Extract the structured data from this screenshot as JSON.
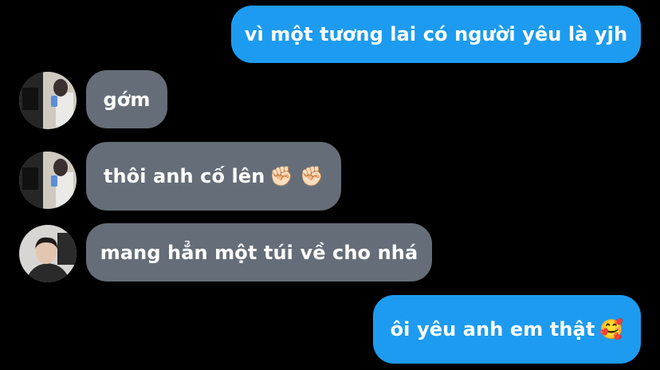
{
  "conversation": {
    "messages": [
      {
        "direction": "outgoing",
        "text": "vì một tương lai có người yêu là yjh"
      },
      {
        "direction": "incoming",
        "sender_avatar": "mirror-selfie-avatar",
        "text": "gớm"
      },
      {
        "direction": "incoming",
        "sender_avatar": "mirror-selfie-avatar",
        "text": "thôi anh cố lên",
        "emoji": "✊🏻 ✊🏻"
      },
      {
        "direction": "incoming",
        "sender_avatar": "portrait-avatar",
        "text": "mang hẳn một túi về cho nhá"
      },
      {
        "direction": "outgoing",
        "text": "ôi yêu anh em thật",
        "emoji": "🥰"
      }
    ]
  },
  "colors": {
    "background": "#000000",
    "outgoing_bubble": "#1d9bf0",
    "incoming_bubble": "#656e78",
    "text": "#ffffff"
  }
}
